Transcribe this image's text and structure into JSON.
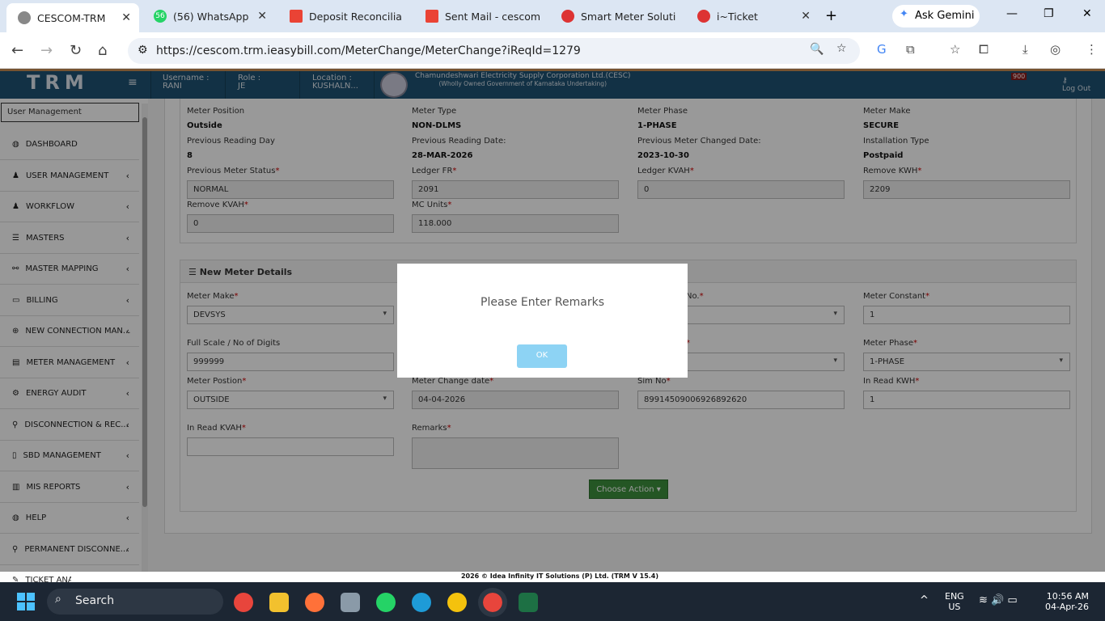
{
  "browser": {
    "tabs": [
      {
        "label": "CESCOM-TRM",
        "active": true
      },
      {
        "label": "(56) WhatsApp",
        "badge": "56"
      },
      {
        "label": "Deposit Reconcilia"
      },
      {
        "label": "Sent Mail - cescom"
      },
      {
        "label": "Smart Meter Soluti"
      },
      {
        "label": "i~Ticket"
      }
    ],
    "ask_gemini": "Ask Gemini",
    "url": "https://cescom.trm.ieasybill.com/MeterChange/MeterChange?iReqId=1279"
  },
  "header": {
    "logo": "TRM",
    "username_label": "Username :",
    "username": "RANI",
    "role_label": "Role :",
    "role": "JE",
    "location_label": "Location :",
    "location": "KUSHALN...",
    "org_name": "Chamundeshwari Electricity Supply Corporation Ltd.(CESC)",
    "org_sub": "(Wholly Owned Government of Karnataka Undertaking)",
    "notification_count": "900",
    "logout": "Log Out"
  },
  "sidebar": {
    "search_value": "User Management",
    "items": [
      {
        "label": "DASHBOARD",
        "icon": "dashboard-icon",
        "chevron": false
      },
      {
        "label": "USER MANAGEMENT",
        "icon": "user-icon",
        "chevron": true
      },
      {
        "label": "WORKFLOW",
        "icon": "user-icon",
        "chevron": true
      },
      {
        "label": "MASTERS",
        "icon": "list-icon",
        "chevron": true
      },
      {
        "label": "MASTER MAPPING",
        "icon": "sitemap-icon",
        "chevron": true
      },
      {
        "label": "BILLING",
        "icon": "monitor-icon",
        "chevron": true
      },
      {
        "label": "NEW CONNECTION MAN...",
        "icon": "plus-circle-icon",
        "chevron": true
      },
      {
        "label": "METER MANAGEMENT",
        "icon": "meter-icon",
        "chevron": true
      },
      {
        "label": "ENERGY AUDIT",
        "icon": "cogs-icon",
        "chevron": true
      },
      {
        "label": "DISCONNECTION & REC...",
        "icon": "plug-icon",
        "chevron": true
      },
      {
        "label": "SBD MANAGEMENT",
        "icon": "box-icon",
        "chevron": true
      },
      {
        "label": "MIS REPORTS",
        "icon": "bar-chart-icon",
        "chevron": true
      },
      {
        "label": "HELP",
        "icon": "dashboard-icon",
        "chevron": true
      },
      {
        "label": "PERMANENT DISCONNE...",
        "icon": "plug-icon",
        "chevron": true
      },
      {
        "label": "TICKET ANA",
        "icon": "ticket-icon",
        "chevron": false
      }
    ]
  },
  "old_meter": {
    "meter_position_label": "Meter Position",
    "meter_position": "Outside",
    "meter_type_label": "Meter Type",
    "meter_type": "NON-DLMS",
    "meter_phase_label": "Meter Phase",
    "meter_phase": "1-PHASE",
    "meter_make_label": "Meter Make",
    "meter_make": "SECURE",
    "prev_reading_day_label": "Previous Reading Day",
    "prev_reading_day": "8",
    "prev_reading_date_label": "Previous Reading Date:",
    "prev_reading_date": "28-MAR-2026",
    "prev_meter_changed_label": "Previous Meter Changed Date:",
    "prev_meter_changed": "2023-10-30",
    "installation_type_label": "Installation Type",
    "installation_type": "Postpaid",
    "prev_meter_status_label": "Previous Meter Status",
    "prev_meter_status": "NORMAL",
    "ledger_fr_label": "Ledger FR",
    "ledger_fr": "2091",
    "ledger_kvah_label": "Ledger KVAH",
    "ledger_kvah": "0",
    "remove_kwh_label": "Remove KWH",
    "remove_kwh": "2209",
    "remove_kvah_label": "Remove KVAH",
    "remove_kvah": "0",
    "mc_units_label": "MC Units",
    "mc_units": "118.000"
  },
  "new_meter": {
    "title": "New Meter Details",
    "meter_make_label": "Meter Make",
    "meter_make": "DEVSYS",
    "serial_label": "No.",
    "meter_constant_label": "Meter Constant",
    "meter_constant": "1",
    "full_scale_label": "Full Scale / No of Digits",
    "full_scale": "999999",
    "meter_phase_label": "Meter Phase",
    "meter_phase": "1-PHASE",
    "meter_position_label": "Meter Postion",
    "meter_position": "OUTSIDE",
    "change_date_label": "Meter Change date",
    "change_date": "04-04-2026",
    "sim_no_label": "Sim No",
    "sim_no": "89914509006926892620",
    "in_read_kwh_label": "In Read KWH",
    "in_read_kwh": "1",
    "in_read_kvah_label": "In Read KVAH",
    "in_read_kvah": "",
    "remarks_label": "Remarks",
    "remarks": "",
    "choose_action": "Choose Action ▾",
    "required_mark": "*"
  },
  "modal": {
    "message": "Please Enter Remarks",
    "ok": "OK"
  },
  "footer": "2026 © Idea Infinity IT Solutions (P) Ltd. (TRM V 15.4)",
  "taskbar": {
    "search": "Search",
    "lang": "ENG",
    "region": "US",
    "time": "10:56 AM",
    "date": "04-Apr-26"
  }
}
